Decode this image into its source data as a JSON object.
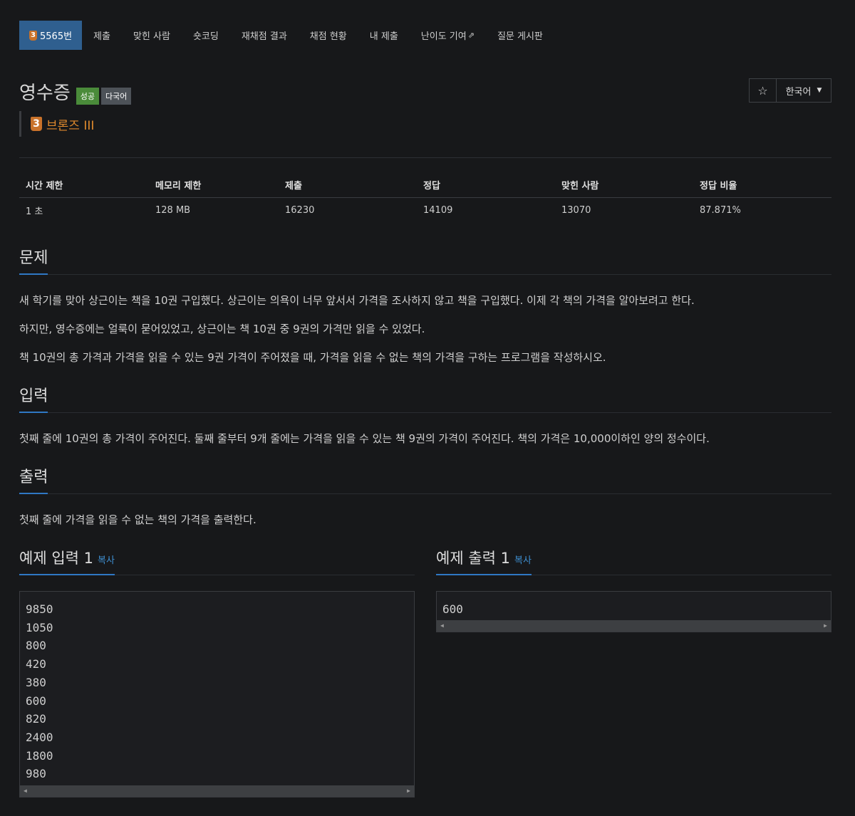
{
  "nav": {
    "problem_tab": {
      "tier": "3",
      "label": "5565번"
    },
    "tabs": [
      "제출",
      "맞힌 사람",
      "숏코딩",
      "재채점 결과",
      "채점 현황",
      "내 제출",
      "난이도 기여",
      "질문 게시판"
    ]
  },
  "header": {
    "title": "영수증",
    "labels": [
      "성공",
      "다국어"
    ],
    "star_icon": "☆",
    "language": "한국어"
  },
  "tier": {
    "badge": "3",
    "name": "브론즈 III"
  },
  "info_table": {
    "headers": [
      "시간 제한",
      "메모리 제한",
      "제출",
      "정답",
      "맞힌 사람",
      "정답 비율"
    ],
    "values": [
      "1 초",
      "128 MB",
      "16230",
      "14109",
      "13070",
      "87.871%"
    ]
  },
  "sections": {
    "problem": {
      "title": "문제",
      "paragraphs": [
        "새 학기를 맞아 상근이는 책을 10권 구입했다. 상근이는 의욕이 너무 앞서서 가격을 조사하지 않고 책을 구입했다. 이제 각 책의 가격을 알아보려고 한다.",
        "하지만, 영수증에는 얼룩이 묻어있었고, 상근이는 책 10권 중 9권의 가격만 읽을 수 있었다.",
        "책 10권의 총 가격과 가격을 읽을 수 있는 9권 가격이 주어졌을 때, 가격을 읽을 수 없는 책의 가격을 구하는 프로그램을 작성하시오."
      ]
    },
    "input": {
      "title": "입력",
      "text": "첫째 줄에 10권의 총 가격이 주어진다. 둘째 줄부터 9개 줄에는 가격을 읽을 수 있는 책 9권의 가격이 주어진다. 책의 가격은 10,000이하인 양의 정수이다."
    },
    "output": {
      "title": "출력",
      "text": "첫째 줄에 가격을 읽을 수 없는 책의 가격을 출력한다."
    }
  },
  "samples": {
    "copy_label": "복사",
    "input_title": "예제 입력 1",
    "output_title": "예제 출력 1",
    "input_lines": [
      "9850",
      "1050",
      "800",
      "420",
      "380",
      "600",
      "820",
      "2400",
      "1800",
      "980"
    ],
    "output_lines": [
      "600"
    ]
  }
}
